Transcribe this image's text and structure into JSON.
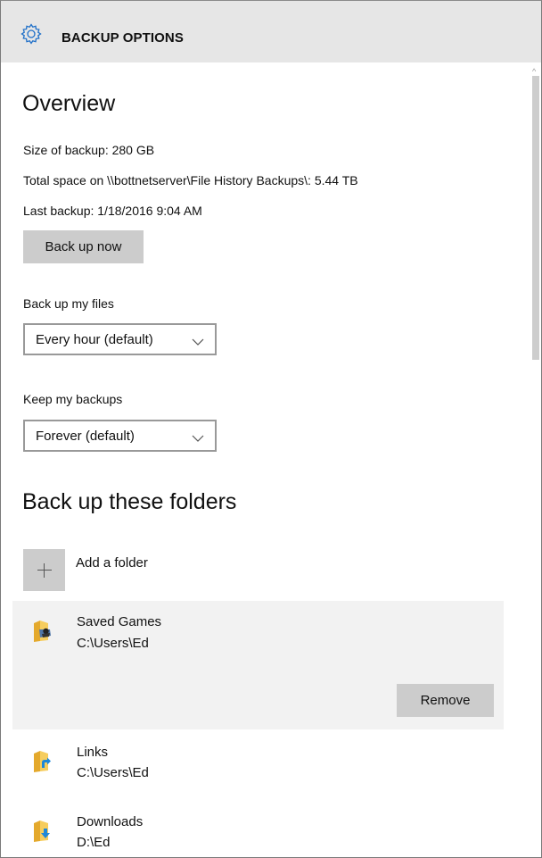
{
  "header": {
    "icon": "gear-icon",
    "title": "BACKUP OPTIONS"
  },
  "overview": {
    "heading": "Overview",
    "size_of_backup": "Size of backup: 280 GB",
    "total_space": "Total space on \\\\bottnetserver\\File History Backups\\: 5.44 TB",
    "last_backup": "Last backup: 1/18/2016 9:04 AM",
    "back_up_now_label": "Back up now"
  },
  "frequency": {
    "label": "Back up my files",
    "selected": "Every hour (default)"
  },
  "retention": {
    "label": "Keep my backups",
    "selected": "Forever (default)"
  },
  "folders": {
    "heading": "Back up these folders",
    "add_label": "Add a folder",
    "remove_label": "Remove",
    "items": [
      {
        "name": "Saved Games",
        "path": "C:\\Users\\Ed",
        "icon": "saved-games-folder-icon",
        "selected": true
      },
      {
        "name": "Links",
        "path": "C:\\Users\\Ed",
        "icon": "links-folder-icon",
        "selected": false
      },
      {
        "name": "Downloads",
        "path": "D:\\Ed",
        "icon": "downloads-folder-icon",
        "selected": false
      }
    ]
  },
  "colors": {
    "titlebar_bg": "#e6e6e6",
    "button_bg": "#cccccc",
    "selected_row_bg": "#f2f2f2",
    "folder_yellow": "#f3c14a",
    "accent_blue": "#1e88d8"
  }
}
